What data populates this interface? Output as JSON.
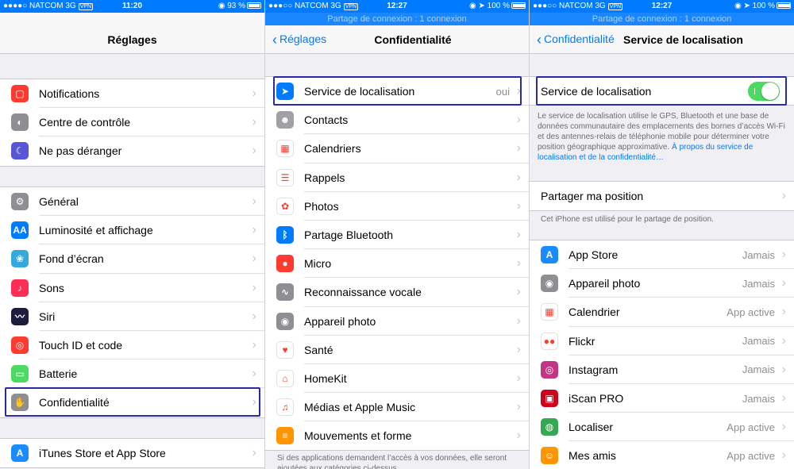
{
  "status_bars": [
    {
      "carrier": "●●●●○ NATCOM",
      "network": "3G",
      "vpn": "VPN",
      "time": "11:20",
      "battery": "93 %",
      "battery_level": 0.93
    },
    {
      "carrier": "●●●○○ NATCOM",
      "network": "3G",
      "vpn": "VPN",
      "time": "12:27",
      "battery": "100 %",
      "battery_level": 1.0
    },
    {
      "carrier": "●●●○○ NATCOM",
      "network": "3G",
      "vpn": "VPN",
      "time": "12:27",
      "battery": "100 %",
      "battery_level": 1.0
    }
  ],
  "hotspot_text": "Partage de connexion : 1 connexion",
  "panel1": {
    "title": "Réglages",
    "group1": [
      {
        "label": "Notifications",
        "icon": "notifications-icon",
        "color": "#ff3b30"
      },
      {
        "label": "Centre de contrôle",
        "icon": "control-center-icon",
        "color": "#8e8e93"
      },
      {
        "label": "Ne pas déranger",
        "icon": "moon-icon",
        "color": "#5856d6"
      }
    ],
    "group2": [
      {
        "label": "Général",
        "icon": "gear-icon",
        "color": "#8e8e93"
      },
      {
        "label": "Luminosité et affichage",
        "icon": "brightness-icon",
        "color": "#007aff"
      },
      {
        "label": "Fond d’écran",
        "icon": "wallpaper-icon",
        "color": "#34aadc"
      },
      {
        "label": "Sons",
        "icon": "speaker-icon",
        "color": "#ff2d55"
      },
      {
        "label": "Siri",
        "icon": "siri-icon",
        "color": "#1c1c3c"
      },
      {
        "label": "Touch ID et code",
        "icon": "fingerprint-icon",
        "color": "#ff3b30"
      },
      {
        "label": "Batterie",
        "icon": "battery-icon",
        "color": "#4cd964"
      },
      {
        "label": "Confidentialité",
        "icon": "hand-icon",
        "color": "#8e8e93"
      }
    ],
    "group3": [
      {
        "label": "iTunes Store et App Store",
        "icon": "app-store-icon",
        "color": "#1a8cff"
      }
    ]
  },
  "panel2": {
    "back": "Réglages",
    "title": "Confidentialité",
    "items": [
      {
        "label": "Service de localisation",
        "value": "oui",
        "icon": "location-arrow-icon",
        "color": "#007aff"
      },
      {
        "label": "Contacts",
        "value": "",
        "icon": "contacts-icon",
        "color": "#a0a0a5"
      },
      {
        "label": "Calendriers",
        "value": "",
        "icon": "calendar-icon",
        "color": "#ffffff"
      },
      {
        "label": "Rappels",
        "value": "",
        "icon": "reminders-icon",
        "color": "#ffffff"
      },
      {
        "label": "Photos",
        "value": "",
        "icon": "photos-icon",
        "color": "#ffffff"
      },
      {
        "label": "Partage Bluetooth",
        "value": "",
        "icon": "bluetooth-icon",
        "color": "#007aff"
      },
      {
        "label": "Micro",
        "value": "",
        "icon": "microphone-icon",
        "color": "#ff3b30"
      },
      {
        "label": "Reconnaissance vocale",
        "value": "",
        "icon": "waveform-icon",
        "color": "#8e8e93"
      },
      {
        "label": "Appareil photo",
        "value": "",
        "icon": "camera-icon",
        "color": "#8e8e93"
      },
      {
        "label": "Santé",
        "value": "",
        "icon": "heart-icon",
        "color": "#ffffff"
      },
      {
        "label": "HomeKit",
        "value": "",
        "icon": "home-icon",
        "color": "#ffffff"
      },
      {
        "label": "Médias et Apple Music",
        "value": "",
        "icon": "music-note-icon",
        "color": "#ffffff"
      },
      {
        "label": "Mouvements et forme",
        "value": "",
        "icon": "motion-icon",
        "color": "#ff9500"
      }
    ],
    "footer": "Si des applications demandent l’accès à vos données, elle seront ajoutées aux catégories ci-dessus."
  },
  "panel3": {
    "back": "Confidentialité",
    "title": "Service de localisation",
    "toggle_label": "Service de localisation",
    "toggle_on": true,
    "description": "Le service de localisation utilise le GPS, Bluetooth et une base de données communautaire des emplacements des bornes d’accès Wi-Fi et des antennes-relais de téléphonie mobile pour déterminer votre position géographique approximative.",
    "description_link": "À propos du service de localisation et de la confidentialité…",
    "share_label": "Partager ma position",
    "share_note": "Cet iPhone est utilisé pour le partage de position.",
    "apps": [
      {
        "label": "App Store",
        "value": "Jamais",
        "icon": "app-store-icon",
        "color": "#1a8cff"
      },
      {
        "label": "Appareil photo",
        "value": "Jamais",
        "icon": "camera-icon",
        "color": "#8e8e93"
      },
      {
        "label": "Calendrier",
        "value": "App active",
        "icon": "calendar-icon",
        "color": "#ffffff"
      },
      {
        "label": "Flickr",
        "value": "Jamais",
        "icon": "flickr-icon",
        "color": "#ffffff"
      },
      {
        "label": "Instagram",
        "value": "Jamais",
        "icon": "instagram-icon",
        "color": "#c13584"
      },
      {
        "label": "iScan PRO",
        "value": "Jamais",
        "icon": "iscan-icon",
        "color": "#d0021b"
      },
      {
        "label": "Localiser",
        "value": "App active",
        "icon": "find-my-icon",
        "color": "#34a853"
      },
      {
        "label": "Mes amis",
        "value": "App active",
        "icon": "friends-icon",
        "color": "#ff9500"
      }
    ]
  }
}
